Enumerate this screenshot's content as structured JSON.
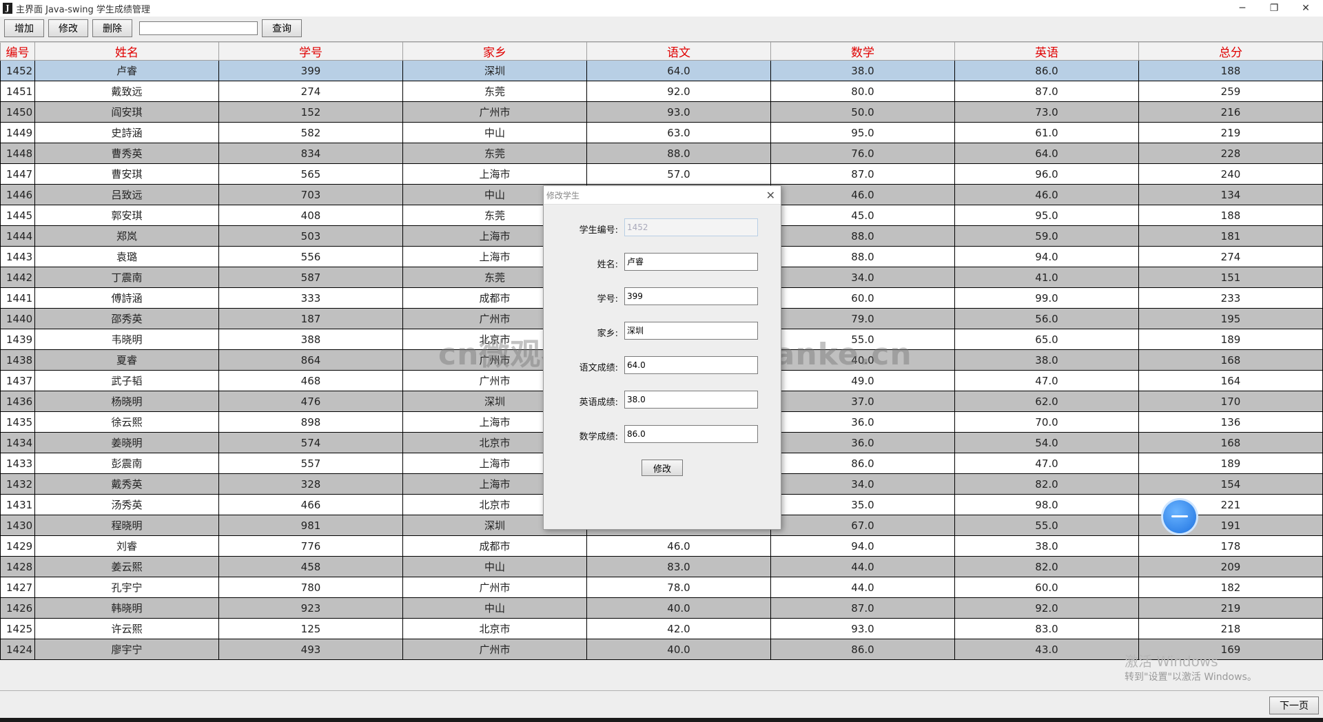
{
  "window": {
    "title": "主界面 Java-swing 学生成绩管理",
    "min": "─",
    "max": "❐",
    "close": "✕"
  },
  "toolbar": {
    "add_label": "增加",
    "edit_label": "修改",
    "delete_label": "删除",
    "search_value": "",
    "query_label": "查询"
  },
  "table": {
    "columns": [
      "编号",
      "姓名",
      "学号",
      "家乡",
      "语文",
      "数学",
      "英语",
      "总分"
    ],
    "rows": [
      [
        "1452",
        "卢睿",
        "399",
        "深圳",
        "64.0",
        "38.0",
        "86.0",
        "188"
      ],
      [
        "1451",
        "戴致远",
        "274",
        "东莞",
        "92.0",
        "80.0",
        "87.0",
        "259"
      ],
      [
        "1450",
        "阎安琪",
        "152",
        "广州市",
        "93.0",
        "50.0",
        "73.0",
        "216"
      ],
      [
        "1449",
        "史詩涵",
        "582",
        "中山",
        "63.0",
        "95.0",
        "61.0",
        "219"
      ],
      [
        "1448",
        "曹秀英",
        "834",
        "东莞",
        "88.0",
        "76.0",
        "64.0",
        "228"
      ],
      [
        "1447",
        "曹安琪",
        "565",
        "上海市",
        "57.0",
        "87.0",
        "96.0",
        "240"
      ],
      [
        "1446",
        "吕致远",
        "703",
        "中山",
        "",
        "46.0",
        "46.0",
        "134"
      ],
      [
        "1445",
        "郭安琪",
        "408",
        "东莞",
        "",
        "45.0",
        "95.0",
        "188"
      ],
      [
        "1444",
        "郑岚",
        "503",
        "上海市",
        "",
        "88.0",
        "59.0",
        "181"
      ],
      [
        "1443",
        "袁璐",
        "556",
        "上海市",
        "",
        "88.0",
        "94.0",
        "274"
      ],
      [
        "1442",
        "丁震南",
        "587",
        "东莞",
        "",
        "34.0",
        "41.0",
        "151"
      ],
      [
        "1441",
        "傅詩涵",
        "333",
        "成都市",
        "",
        "60.0",
        "99.0",
        "233"
      ],
      [
        "1440",
        "邵秀英",
        "187",
        "广州市",
        "",
        "79.0",
        "56.0",
        "195"
      ],
      [
        "1439",
        "韦晓明",
        "388",
        "北京市",
        "",
        "55.0",
        "65.0",
        "189"
      ],
      [
        "1438",
        "夏睿",
        "864",
        "广州市",
        "",
        "40.0",
        "38.0",
        "168"
      ],
      [
        "1437",
        "武子韬",
        "468",
        "广州市",
        "",
        "49.0",
        "47.0",
        "164"
      ],
      [
        "1436",
        "杨晓明",
        "476",
        "深圳",
        "",
        "37.0",
        "62.0",
        "170"
      ],
      [
        "1435",
        "徐云熙",
        "898",
        "上海市",
        "",
        "36.0",
        "70.0",
        "136"
      ],
      [
        "1434",
        "姜晓明",
        "574",
        "北京市",
        "",
        "36.0",
        "54.0",
        "168"
      ],
      [
        "1433",
        "彭震南",
        "557",
        "上海市",
        "",
        "86.0",
        "47.0",
        "189"
      ],
      [
        "1432",
        "戴秀英",
        "328",
        "上海市",
        "",
        "34.0",
        "82.0",
        "154"
      ],
      [
        "1431",
        "汤秀英",
        "466",
        "北京市",
        "",
        "35.0",
        "98.0",
        "221"
      ],
      [
        "1430",
        "程晓明",
        "981",
        "深圳",
        "",
        "67.0",
        "55.0",
        "191"
      ],
      [
        "1429",
        "刘睿",
        "776",
        "成都市",
        "46.0",
        "94.0",
        "38.0",
        "178"
      ],
      [
        "1428",
        "姜云熙",
        "458",
        "中山",
        "83.0",
        "44.0",
        "82.0",
        "209"
      ],
      [
        "1427",
        "孔宇宁",
        "780",
        "广州市",
        "78.0",
        "44.0",
        "60.0",
        "182"
      ],
      [
        "1426",
        "韩晓明",
        "923",
        "中山",
        "40.0",
        "87.0",
        "92.0",
        "219"
      ],
      [
        "1425",
        "许云熙",
        "125",
        "北京市",
        "42.0",
        "93.0",
        "83.0",
        "218"
      ],
      [
        "1424",
        "廖宇宁",
        "493",
        "广州市",
        "40.0",
        "86.0",
        "43.0",
        "169"
      ]
    ],
    "selected_index": 0
  },
  "dialog": {
    "title": "修改学生",
    "close": "✕",
    "fields": [
      {
        "label": "学生编号:",
        "value": "1452",
        "disabled": true
      },
      {
        "label": "姓名:",
        "value": "卢睿",
        "disabled": false
      },
      {
        "label": "学号:",
        "value": "399",
        "disabled": false
      },
      {
        "label": "家乡:",
        "value": "深圳",
        "disabled": false
      },
      {
        "label": "语文成绩:",
        "value": "64.0",
        "disabled": false
      },
      {
        "label": "英语成绩:",
        "value": "38.0",
        "disabled": false
      },
      {
        "label": "数学成绩:",
        "value": "86.0",
        "disabled": false
      }
    ],
    "submit_label": "修改"
  },
  "pagination": {
    "next_label": "下一页"
  },
  "watermark": {
    "text": "cn微观客www.weiguanke.cn"
  },
  "os_notice": {
    "title": "激活 Windows",
    "subtitle": "转到\"设置\"以激活 Windows。"
  }
}
